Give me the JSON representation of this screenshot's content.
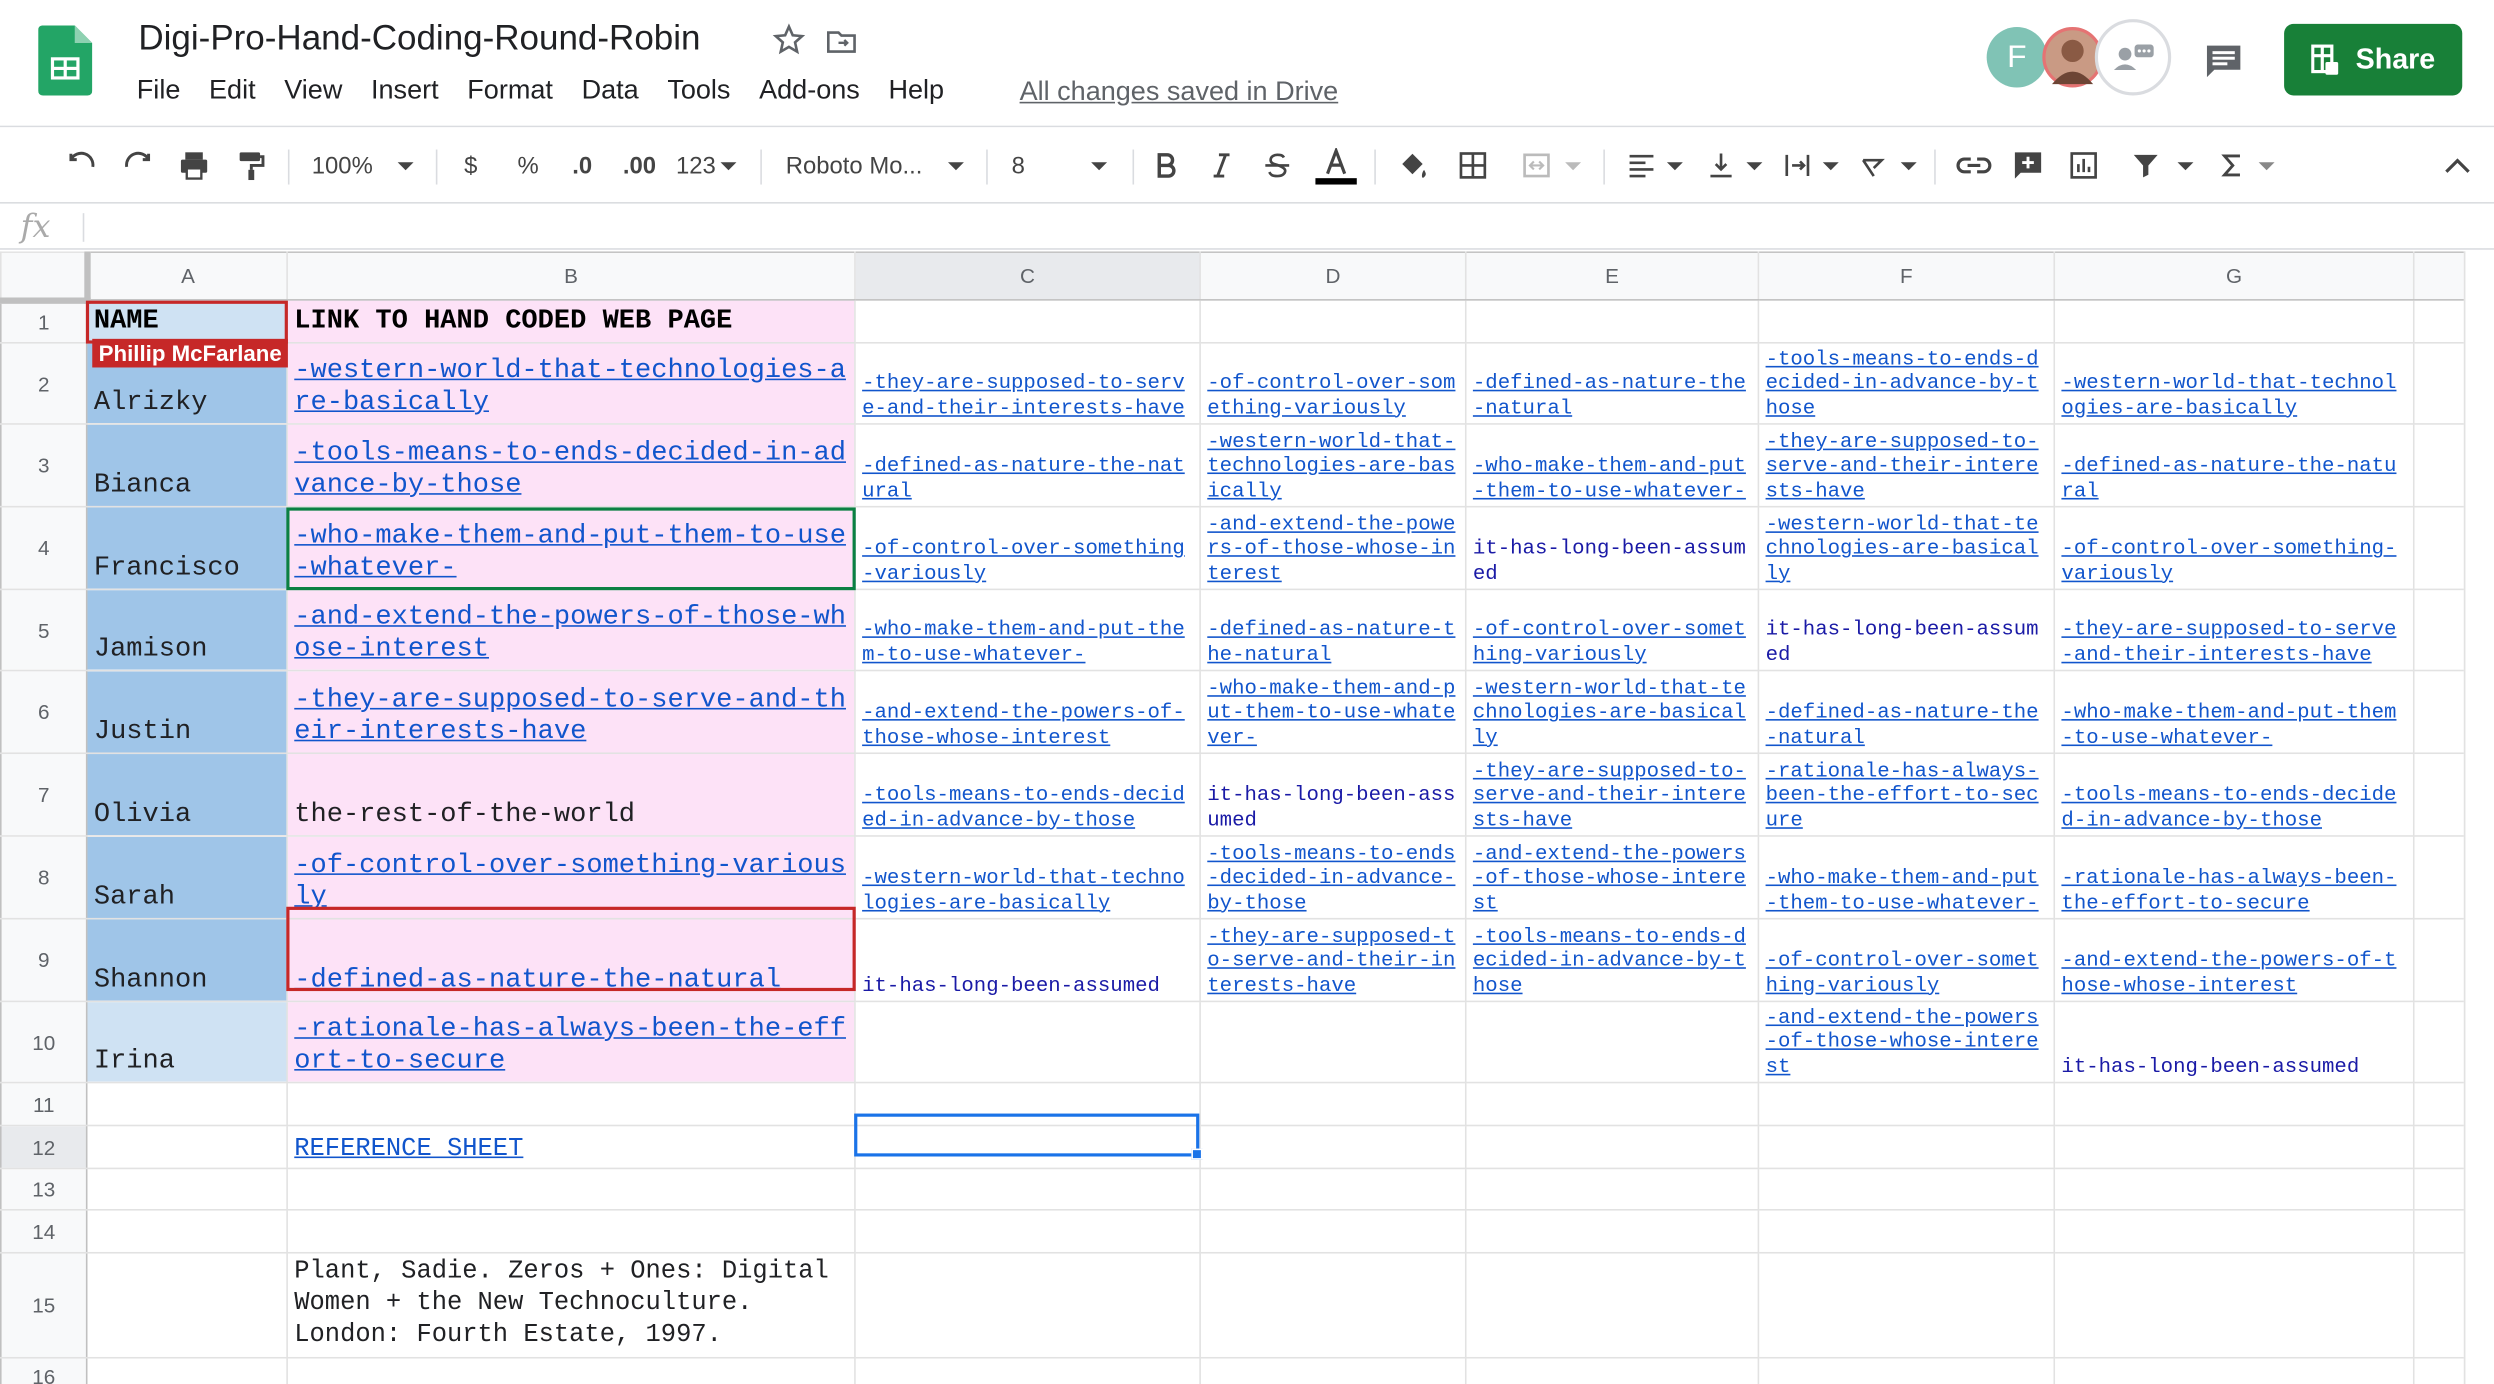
{
  "header": {
    "title": "Digi-Pro-Hand-Coding-Round-Robin",
    "save_status": "All changes saved in Drive",
    "share_label": "Share",
    "avatar_initial": "F",
    "brand_color": "#188038",
    "menu": [
      "File",
      "Edit",
      "View",
      "Insert",
      "Format",
      "Data",
      "Tools",
      "Add-ons",
      "Help"
    ]
  },
  "toolbar": {
    "zoom": "100%",
    "currency": "$",
    "percent": "%",
    "dec_less": ".0",
    "dec_more": ".00",
    "format_more": "123",
    "font": "Roboto Mo...",
    "font_size": "8",
    "icons": [
      "undo-icon",
      "redo-icon",
      "print-icon",
      "paint-format-icon",
      "bold-icon",
      "italic-icon",
      "strikethrough-icon",
      "text-color-icon",
      "fill-color-icon",
      "borders-icon",
      "merge-icon",
      "align-icon",
      "valign-icon",
      "wrap-icon",
      "rotate-icon",
      "link-icon",
      "comment-icon",
      "chart-icon",
      "filter-icon",
      "functions-icon"
    ]
  },
  "formula_bar": {
    "fx": "fx",
    "value": ""
  },
  "collaborator_tag": "Phillip McFarlane",
  "columns": [
    "A",
    "B",
    "C",
    "D",
    "E",
    "F",
    "G"
  ],
  "rows": [
    {
      "num": "1",
      "cells": [
        "NAME",
        "LINK TO HAND CODED WEB PAGE",
        "",
        "",
        "",
        "",
        ""
      ]
    },
    {
      "num": "2",
      "cells": [
        "Alrizky",
        "-western-world-that-technologies-are-basically",
        "-they-are-supposed-to-serve-and-their-interests-have",
        "-of-control-over-something-variously",
        "-defined-as-nature-the-natural",
        "-tools-means-to-ends-decided-in-advance-by-those",
        "-western-world-that-technologies-are-basically"
      ]
    },
    {
      "num": "3",
      "cells": [
        "Bianca",
        "-tools-means-to-ends-decided-in-advance-by-those",
        "-defined-as-nature-the-natural",
        "-western-world-that-technologies-are-basically",
        "-who-make-them-and-put-them-to-use-whatever-",
        "-they-are-supposed-to-serve-and-their-interests-have",
        "-defined-as-nature-the-natural"
      ]
    },
    {
      "num": "4",
      "cells": [
        "Francisco",
        "-who-make-them-and-put-them-to-use-whatever-",
        "-of-control-over-something-variously",
        "-and-extend-the-powers-of-those-whose-interest",
        "it-has-long-been-assumed",
        "-western-world-that-technologies-are-basically",
        "-of-control-over-something-variously"
      ]
    },
    {
      "num": "5",
      "cells": [
        "Jamison",
        "-and-extend-the-powers-of-those-whose-interest",
        "-who-make-them-and-put-them-to-use-whatever-",
        "-defined-as-nature-the-natural",
        "-of-control-over-something-variously",
        "it-has-long-been-assumed",
        "-they-are-supposed-to-serve-and-their-interests-have"
      ]
    },
    {
      "num": "6",
      "cells": [
        "Justin",
        "-they-are-supposed-to-serve-and-their-interests-have",
        "-and-extend-the-powers-of-those-whose-interest",
        "-who-make-them-and-put-them-to-use-whatever-",
        "-western-world-that-technologies-are-basically",
        "-defined-as-nature-the-natural",
        "-who-make-them-and-put-them-to-use-whatever-"
      ]
    },
    {
      "num": "7",
      "cells": [
        "Olivia",
        "the-rest-of-the-world",
        "-tools-means-to-ends-decided-in-advance-by-those",
        "it-has-long-been-assumed",
        "-they-are-supposed-to-serve-and-their-interests-have",
        "-rationale-has-always-been-the-effort-to-secure",
        "-tools-means-to-ends-decided-in-advance-by-those"
      ]
    },
    {
      "num": "8",
      "cells": [
        "Sarah",
        "-of-control-over-something-variously",
        "-western-world-that-technologies-are-basically",
        "-tools-means-to-ends-decided-in-advance-by-those",
        "-and-extend-the-powers-of-those-whose-interest",
        "-who-make-them-and-put-them-to-use-whatever-",
        "-rationale-has-always-been-the-effort-to-secure"
      ]
    },
    {
      "num": "9",
      "cells": [
        "Shannon",
        "-defined-as-nature-the-natural",
        "it-has-long-been-assumed",
        "-they-are-supposed-to-serve-and-their-interests-have",
        "-tools-means-to-ends-decided-in-advance-by-those",
        "-of-control-over-something-variously",
        "-and-extend-the-powers-of-those-whose-interest"
      ]
    },
    {
      "num": "10",
      "cells": [
        "Irina",
        "-rationale-has-always-been-the-effort-to-secure",
        "",
        "",
        "",
        "-and-extend-the-powers-of-those-whose-interest",
        "it-has-long-been-assumed"
      ]
    },
    {
      "num": "11",
      "cells": [
        "",
        "",
        "",
        "",
        "",
        "",
        ""
      ]
    },
    {
      "num": "12",
      "cells": [
        "",
        "REFERENCE SHEET",
        "",
        "",
        "",
        "",
        ""
      ]
    },
    {
      "num": "13",
      "cells": [
        "",
        "",
        "",
        "",
        "",
        "",
        ""
      ]
    },
    {
      "num": "14",
      "cells": [
        "",
        "",
        "",
        "",
        "",
        "",
        ""
      ]
    },
    {
      "num": "15",
      "cells": [
        "",
        "Plant, Sadie. Zeros + Ones: Digital Women + the New Technoculture. London: Fourth Estate, 1997.",
        "",
        "",
        "",
        "",
        ""
      ]
    },
    {
      "num": "16",
      "cells": [
        "",
        "",
        "",
        "",
        "",
        "",
        ""
      ]
    }
  ]
}
